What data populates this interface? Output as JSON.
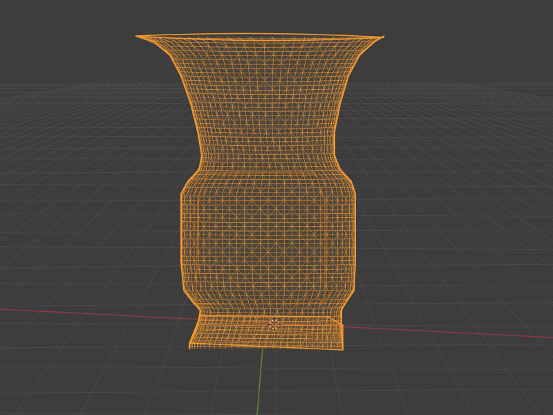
{
  "viewport": {
    "background": "#3d3d3d",
    "grid_color": "#4a4a4a",
    "x_axis_color": "#8b3a45",
    "y_axis_color": "#5c8a2f",
    "wire_color": "#f59a32",
    "wire_dark": "#b86a18",
    "cursor_color": "#e8e8e8",
    "cursor_accent": "#c23b3b"
  },
  "object": {
    "kind": "vase-mesh",
    "display": "wireframe",
    "selected": true
  },
  "cursor": {
    "icon": "3d-cursor-icon"
  }
}
